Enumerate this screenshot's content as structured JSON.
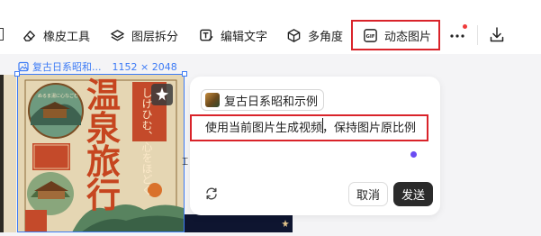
{
  "toolbar": {
    "items": [
      {
        "label": "橡皮工具",
        "icon": "eraser-icon"
      },
      {
        "label": "图层拆分",
        "icon": "layers-icon"
      },
      {
        "label": "编辑文字",
        "icon": "edit-text-icon"
      },
      {
        "label": "多角度",
        "icon": "cube-icon"
      },
      {
        "label": "动态图片",
        "icon": "gif-icon"
      }
    ],
    "more_icon": "more-icon",
    "download_icon": "download-icon"
  },
  "canvas": {
    "image_name": "复古日系昭和...",
    "image_dimensions": "1152 × 2048"
  },
  "poster": {
    "title_line1": "温",
    "title_line2": "泉",
    "title_line3": "旅",
    "title_line4": "行",
    "side_text": "しけひむ、心をほどく",
    "small_text": "ぬるま湯に心なごむ"
  },
  "prompt_panel": {
    "reference_chip": "复古日系昭和示例",
    "prompt_text": "使用当前图片生成视频，保持图片原比例",
    "cancel_label": "取消",
    "send_label": "发送"
  },
  "colors": {
    "accent_blue": "#3d7bf5",
    "highlight_red": "#d9232a",
    "send_button": "#2b2b2b",
    "status_purple": "#6a4cf2"
  }
}
